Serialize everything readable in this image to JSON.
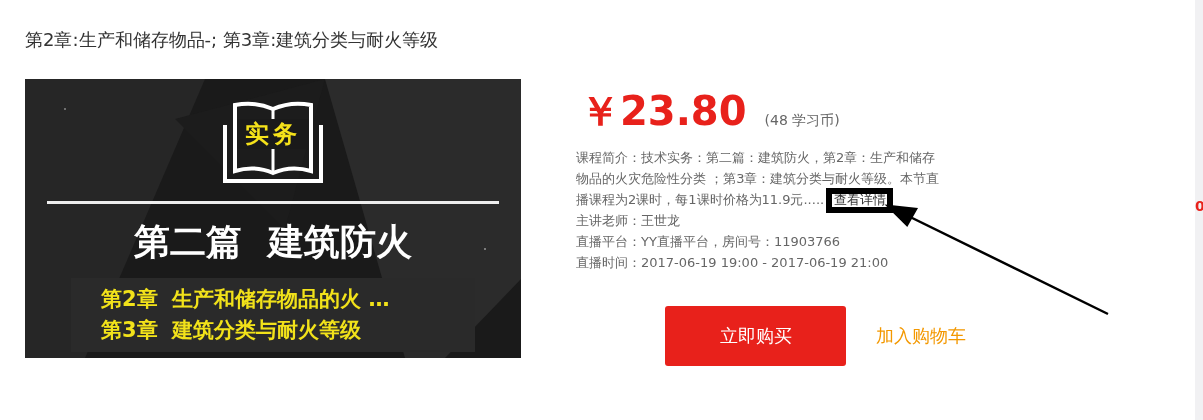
{
  "page_title": "第2章:生产和储存物品-; 第3章:建筑分类与耐火等级",
  "cover": {
    "book_label": "实务",
    "heading": "第二篇  建筑防火",
    "chapters": [
      "第2章  生产和储存物品的火 …",
      "第3章  建筑分类与耐火等级"
    ]
  },
  "price": {
    "amount": "￥23.80",
    "coins": "(48  学习币)"
  },
  "description": {
    "text": "课程简介：技术实务：第二篇：建筑防火，第2章：生产和储存物品的火灾危险性分类 ；第3章：建筑分类与耐火等级。本节直播课程为2课时，每1课时价格为11.9元.....",
    "link": "查看详情"
  },
  "details": [
    "主讲老师：王世龙",
    "直播平台：YY直播平台，房间号：11903766",
    "直播时间：2017-06-19 19:00 - 2017-06-19 21:00"
  ],
  "buy_button": "立即购买",
  "cart_link": "加入购物车",
  "side_badge": "0",
  "annotation": {
    "box": true,
    "arrow": true
  }
}
